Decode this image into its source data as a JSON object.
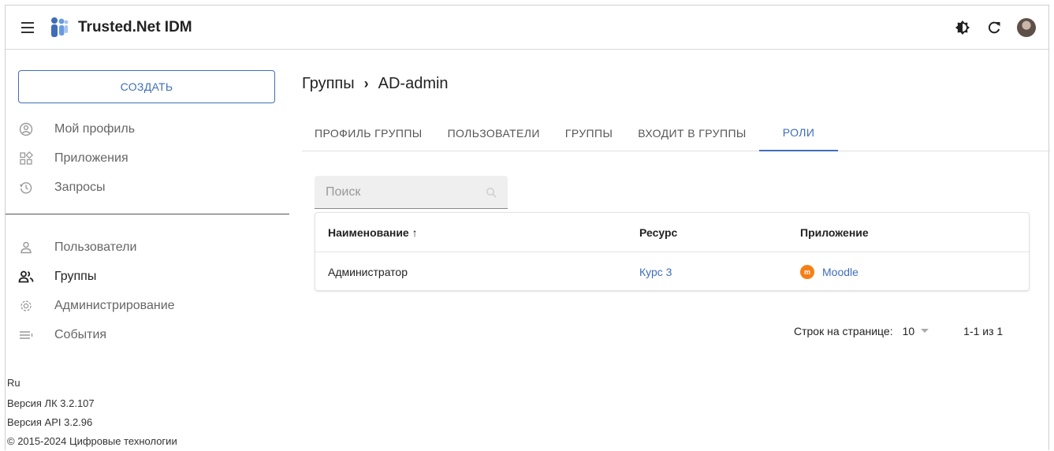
{
  "app": {
    "title": "Trusted.Net IDM"
  },
  "header": {
    "icons": [
      "menu-icon",
      "theme-icon",
      "refresh-icon",
      "avatar"
    ]
  },
  "sidebar": {
    "create_label": "СОЗДАТЬ",
    "items": [
      {
        "label": "Мой профиль",
        "icon": "profile-icon"
      },
      {
        "label": "Приложения",
        "icon": "apps-icon"
      },
      {
        "label": "Запросы",
        "icon": "history-icon"
      },
      {
        "label": "Пользователи",
        "icon": "user-icon"
      },
      {
        "label": "Группы",
        "icon": "groups-icon",
        "active": true
      },
      {
        "label": "Администрирование",
        "icon": "gear-icon"
      },
      {
        "label": "События",
        "icon": "events-icon"
      }
    ],
    "footer": {
      "lang": "Ru",
      "version_lk": "Версия ЛК 3.2.107",
      "version_api": "Версия API 3.2.96",
      "copyright": "© 2015-2024 Цифровые технологии"
    }
  },
  "breadcrumb": {
    "parent": "Группы",
    "sep": "›",
    "current": "AD-admin"
  },
  "tabs": [
    {
      "label": "ПРОФИЛЬ ГРУППЫ"
    },
    {
      "label": "ПОЛЬЗОВАТЕЛИ"
    },
    {
      "label": "ГРУППЫ"
    },
    {
      "label": "ВХОДИТ В ГРУППЫ"
    },
    {
      "label": "РОЛИ",
      "active": true
    }
  ],
  "search": {
    "placeholder": "Поиск"
  },
  "table": {
    "columns": [
      "Наименование ↑",
      "Ресурс",
      "Приложение"
    ],
    "rows": [
      {
        "name": "Администратор",
        "resource": "Курс 3",
        "app": "Moodle"
      }
    ]
  },
  "pager": {
    "rows_label": "Строк на странице:",
    "rows_value": "10",
    "range": "1-1 из 1"
  },
  "colors": {
    "accent": "#3f6eb8",
    "moodle": "#f57f17"
  }
}
